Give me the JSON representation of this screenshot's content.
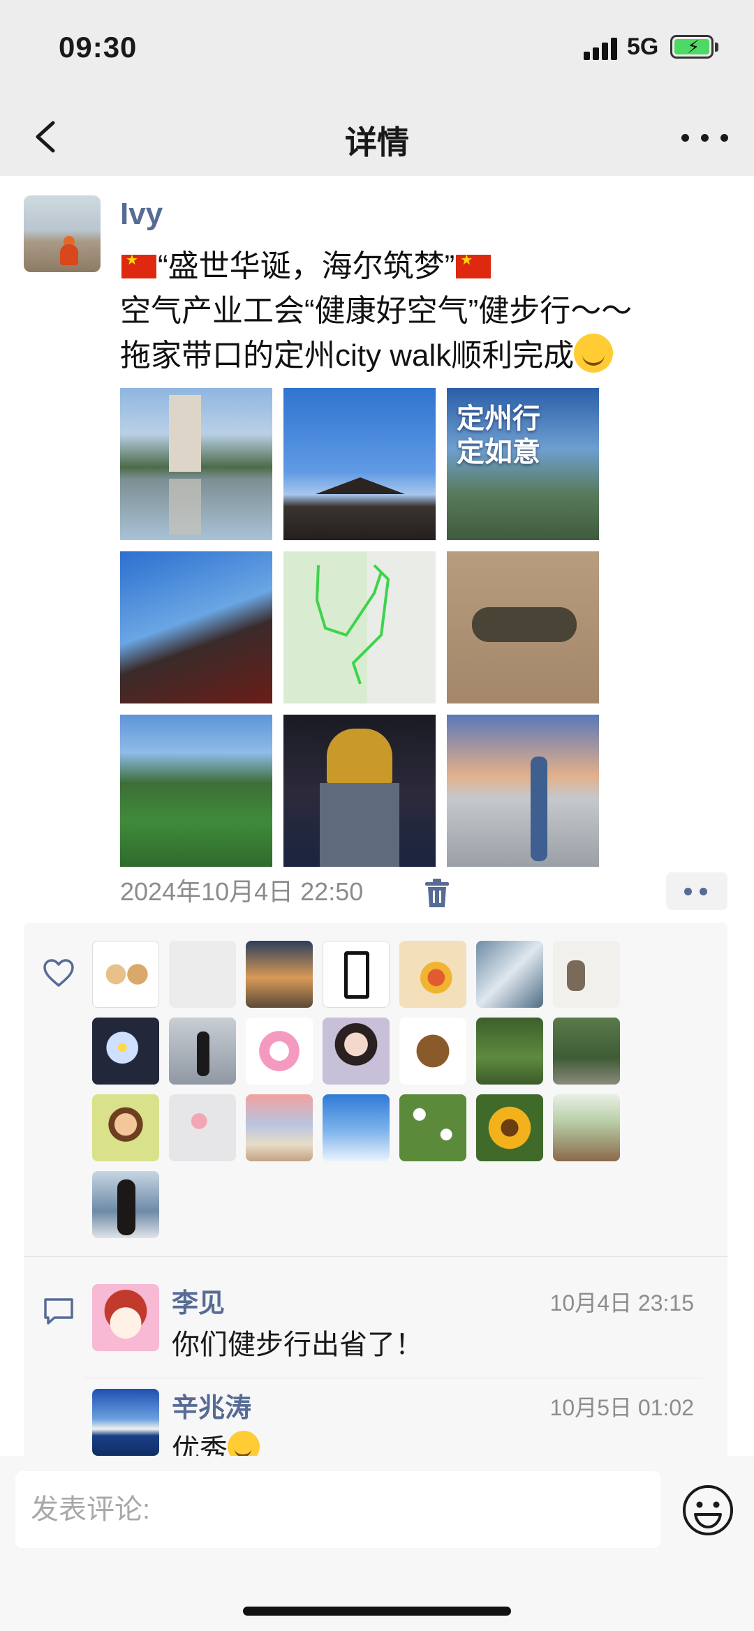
{
  "status_bar": {
    "time": "09:30",
    "network": "5G"
  },
  "nav": {
    "title": "详情"
  },
  "post": {
    "author": "Ivy",
    "lines": [
      {
        "before": "",
        "text": "“盛世华诞，海尔筑梦”",
        "after": ""
      },
      {
        "text": "空气产业工会“健康好空气”健步行～～"
      },
      {
        "text": "拖家带口的定州city walk顺利完成"
      }
    ],
    "photo_caption": "定州行\n定如意",
    "timestamp": "2024年10月4日 22:50"
  },
  "likes": {
    "count": 22
  },
  "comments": [
    {
      "name": "李见",
      "time": "10月4日 23:15",
      "text": "你们健步行出省了！"
    },
    {
      "name": "辛兆涛",
      "time": "10月5日 01:02",
      "text": "优秀"
    }
  ],
  "comment_bar": {
    "placeholder": "发表评论:"
  },
  "colors": {
    "link_blue": "#576b95",
    "nav_bg": "#ededed",
    "panel_bg": "#f7f7f7",
    "meta_gray": "#8c8c8c"
  }
}
